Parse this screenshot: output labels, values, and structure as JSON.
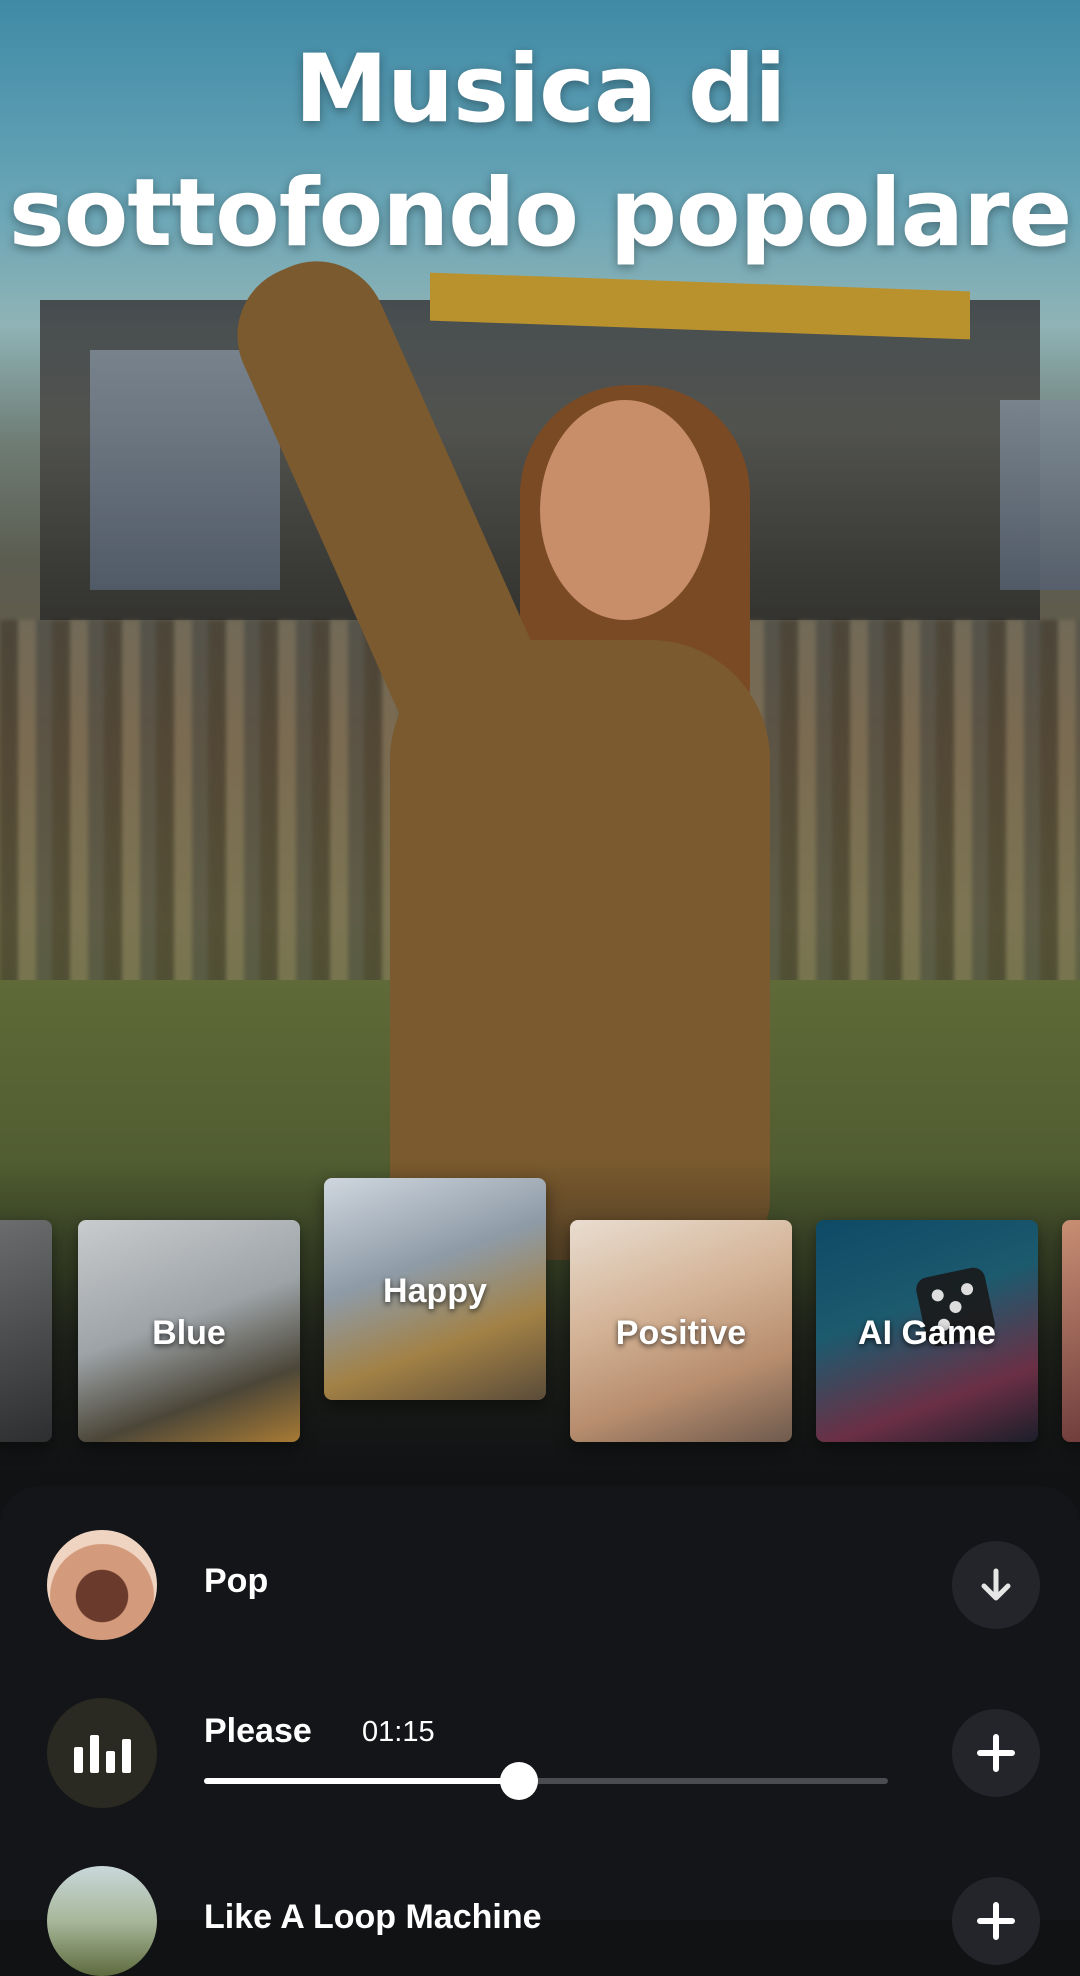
{
  "headline": {
    "line1": "Musica di",
    "line2": "sottofondo popolare"
  },
  "categories": [
    {
      "label": ""
    },
    {
      "label": "Blue"
    },
    {
      "label": "Happy"
    },
    {
      "label": "Positive"
    },
    {
      "label": "AI Game"
    },
    {
      "label": ""
    }
  ],
  "tracks": [
    {
      "title": "Pop",
      "action_icon": "download-icon"
    },
    {
      "title": "Please",
      "duration": "01:15",
      "progress": 0.46,
      "action_icon": "plus-icon"
    },
    {
      "title": "Like A Loop Machine",
      "action_icon": "plus-icon"
    }
  ],
  "colors": {
    "background": "#111214",
    "panel": "#141518",
    "button_bg": "#23252a",
    "slider_track": "#4a4c52",
    "slider_fill": "#ffffff"
  }
}
